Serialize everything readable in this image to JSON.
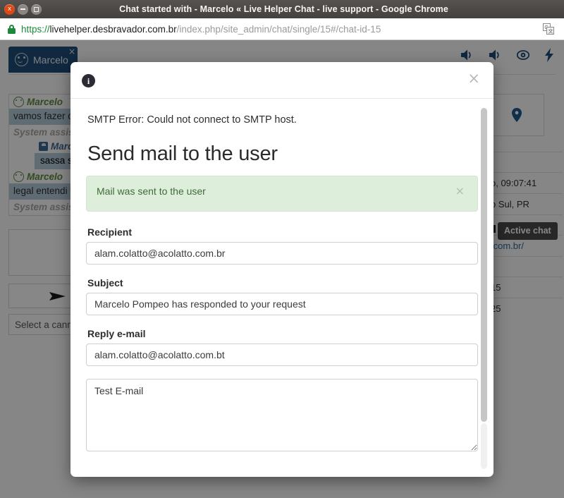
{
  "browser": {
    "window_title": "Chat started with - Marcelo « Live Helper Chat - live support - Google Chrome",
    "url_scheme": "https://",
    "url_host": "livehelper.desbravador.com.br",
    "url_path": "/index.php/site_admin/chat/single/15#/chat-id-15",
    "close_label": "x",
    "minimize_label": "",
    "maximize_label": "",
    "lock_icon": "lock-icon",
    "translate_icon": "translate-icon"
  },
  "page": {
    "tab": {
      "label": "Marcelo",
      "close_label": "×",
      "avatar_icon": "user-face-icon"
    },
    "header_icons": [
      {
        "name": "sound-on-icon"
      },
      {
        "name": "sound-alert-icon"
      },
      {
        "name": "eye-icon"
      },
      {
        "name": "lightning-icon"
      }
    ],
    "messages": [
      {
        "author": "Marcelo",
        "type": "visitor",
        "text": "vamos fazer o tr"
      },
      {
        "author": "System assistant",
        "type": "system",
        "text": ""
      },
      {
        "author": "Marcelo",
        "type": "operator",
        "text": "sassa sa s"
      },
      {
        "author": "Marcelo",
        "type": "visitor",
        "text": "legal entendi tud"
      },
      {
        "author": "System assistant",
        "type": "system",
        "text": ""
      }
    ],
    "send_button_icon": "send-arrow-icon",
    "canned_placeholder": "Select a canned message",
    "side": {
      "map_pin_icon": "location-pin-icon",
      "active_chat_badge": "Active chat",
      "rows": [
        "o, 09:07:41",
        "o Sul, PR",
        "",
        ".com.br/",
        "",
        "15",
        "25"
      ]
    }
  },
  "modal": {
    "info_icon": "info-icon",
    "info_glyph": "i",
    "close_label": "×",
    "smtp_error": "SMTP Error: Could not connect to SMTP host.",
    "title": "Send mail to the user",
    "alert": {
      "text": "Mail was sent to the user",
      "close_label": "×",
      "bg_color": "#ddeeda",
      "text_color": "#3f6b38"
    },
    "fields": [
      {
        "label": "Recipient",
        "value": "alam.colatto@acolatto.com.br",
        "placeholder": "",
        "name": "recipient"
      },
      {
        "label": "Subject",
        "value": "Marcelo Pompeo has responded to your request",
        "placeholder": "",
        "name": "subject"
      },
      {
        "label": "Reply e-mail",
        "value": "alam.colatto@acolatto.com.bt",
        "placeholder": "",
        "name": "reply-email"
      }
    ],
    "message_body": "Test E-mail",
    "message_placeholder": ""
  }
}
